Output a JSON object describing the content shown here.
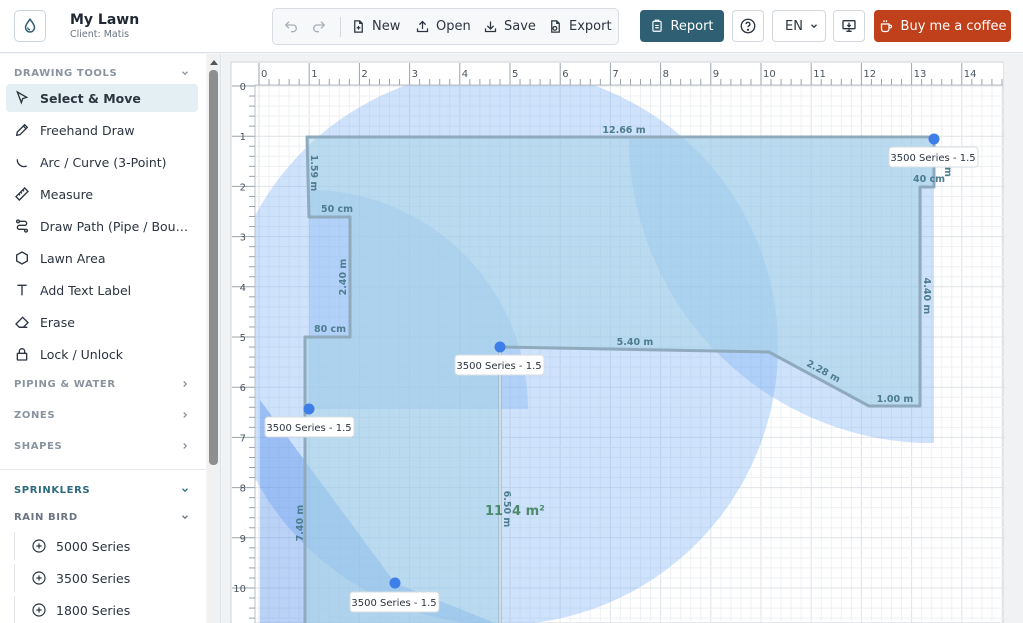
{
  "app": {
    "title": "My Lawn",
    "client": "Client: Matis"
  },
  "toolbar": {
    "undo_icon": "undo-icon",
    "redo_icon": "redo-icon",
    "new_label": "New",
    "open_label": "Open",
    "save_label": "Save",
    "export_label": "Export"
  },
  "header": {
    "report_label": "Report",
    "help_icon": "question-mark-icon",
    "language": "EN",
    "display_icon": "monitor-icon",
    "coffee_label": "Buy me a coffee"
  },
  "sidebar": {
    "drawing_tools": {
      "title": "DRAWING TOOLS",
      "items": [
        {
          "label": "Select & Move",
          "icon": "cursor-icon",
          "active": true
        },
        {
          "label": "Freehand Draw",
          "icon": "pencil-icon"
        },
        {
          "label": "Arc / Curve (3-Point)",
          "icon": "arc-icon"
        },
        {
          "label": "Measure",
          "icon": "ruler-icon"
        },
        {
          "label": "Draw Path (Pipe / Boundary)",
          "icon": "path-icon"
        },
        {
          "label": "Lawn Area",
          "icon": "hexagon-icon"
        },
        {
          "label": "Add Text Label",
          "icon": "text-icon"
        },
        {
          "label": "Erase",
          "icon": "eraser-icon"
        },
        {
          "label": "Lock / Unlock",
          "icon": "lock-icon"
        }
      ]
    },
    "collapsed_sections": [
      "PIPING & WATER",
      "ZONES",
      "SHAPES"
    ],
    "sprinklers": {
      "title": "SPRINKLERS",
      "brand": "RAIN BIRD",
      "series": [
        "5000 Series",
        "3500 Series",
        "1800 Series"
      ]
    }
  },
  "canvas": {
    "x_ticks": [
      "0",
      "1",
      "2",
      "3",
      "4",
      "5",
      "6",
      "7",
      "8",
      "9",
      "10",
      "11",
      "12",
      "13",
      "14"
    ],
    "y_ticks": [
      "0",
      "1",
      "2",
      "3",
      "4",
      "5",
      "6",
      "7",
      "8",
      "9",
      "10"
    ],
    "area_label": "11?.4 m²",
    "area_label_parts": [
      "11",
      "4 m²"
    ],
    "dimensions": [
      "12.66 m",
      "1.59 m",
      "50 cm",
      "2.40 m",
      "80 cm",
      "7.40 m",
      "40 cm",
      "4.40 m",
      "5.40 m",
      "2.28 m",
      "1.00 m",
      "6.50 m",
      "m"
    ],
    "sprinklers": [
      {
        "label": "3500 Series - 1.5"
      },
      {
        "label": "3500 Series - 1.5"
      },
      {
        "label": "3500 Series - 1.5"
      },
      {
        "label": "3500 Series - 1.5"
      }
    ],
    "colors": {
      "zone_fill": "#a8d4e6",
      "spray": "#7fb3f5",
      "head": "#3d7ee8",
      "outline": "#8fa9bd"
    }
  }
}
